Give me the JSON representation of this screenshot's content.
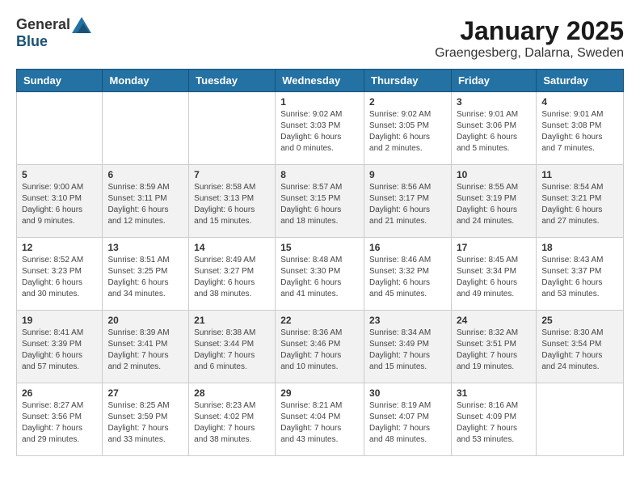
{
  "logo": {
    "general": "General",
    "blue": "Blue"
  },
  "title": "January 2025",
  "subtitle": "Graengesberg, Dalarna, Sweden",
  "days_of_week": [
    "Sunday",
    "Monday",
    "Tuesday",
    "Wednesday",
    "Thursday",
    "Friday",
    "Saturday"
  ],
  "weeks": [
    [
      {
        "day": "",
        "info": ""
      },
      {
        "day": "",
        "info": ""
      },
      {
        "day": "",
        "info": ""
      },
      {
        "day": "1",
        "info": "Sunrise: 9:02 AM\nSunset: 3:03 PM\nDaylight: 6 hours\nand 0 minutes."
      },
      {
        "day": "2",
        "info": "Sunrise: 9:02 AM\nSunset: 3:05 PM\nDaylight: 6 hours\nand 2 minutes."
      },
      {
        "day": "3",
        "info": "Sunrise: 9:01 AM\nSunset: 3:06 PM\nDaylight: 6 hours\nand 5 minutes."
      },
      {
        "day": "4",
        "info": "Sunrise: 9:01 AM\nSunset: 3:08 PM\nDaylight: 6 hours\nand 7 minutes."
      }
    ],
    [
      {
        "day": "5",
        "info": "Sunrise: 9:00 AM\nSunset: 3:10 PM\nDaylight: 6 hours\nand 9 minutes."
      },
      {
        "day": "6",
        "info": "Sunrise: 8:59 AM\nSunset: 3:11 PM\nDaylight: 6 hours\nand 12 minutes."
      },
      {
        "day": "7",
        "info": "Sunrise: 8:58 AM\nSunset: 3:13 PM\nDaylight: 6 hours\nand 15 minutes."
      },
      {
        "day": "8",
        "info": "Sunrise: 8:57 AM\nSunset: 3:15 PM\nDaylight: 6 hours\nand 18 minutes."
      },
      {
        "day": "9",
        "info": "Sunrise: 8:56 AM\nSunset: 3:17 PM\nDaylight: 6 hours\nand 21 minutes."
      },
      {
        "day": "10",
        "info": "Sunrise: 8:55 AM\nSunset: 3:19 PM\nDaylight: 6 hours\nand 24 minutes."
      },
      {
        "day": "11",
        "info": "Sunrise: 8:54 AM\nSunset: 3:21 PM\nDaylight: 6 hours\nand 27 minutes."
      }
    ],
    [
      {
        "day": "12",
        "info": "Sunrise: 8:52 AM\nSunset: 3:23 PM\nDaylight: 6 hours\nand 30 minutes."
      },
      {
        "day": "13",
        "info": "Sunrise: 8:51 AM\nSunset: 3:25 PM\nDaylight: 6 hours\nand 34 minutes."
      },
      {
        "day": "14",
        "info": "Sunrise: 8:49 AM\nSunset: 3:27 PM\nDaylight: 6 hours\nand 38 minutes."
      },
      {
        "day": "15",
        "info": "Sunrise: 8:48 AM\nSunset: 3:30 PM\nDaylight: 6 hours\nand 41 minutes."
      },
      {
        "day": "16",
        "info": "Sunrise: 8:46 AM\nSunset: 3:32 PM\nDaylight: 6 hours\nand 45 minutes."
      },
      {
        "day": "17",
        "info": "Sunrise: 8:45 AM\nSunset: 3:34 PM\nDaylight: 6 hours\nand 49 minutes."
      },
      {
        "day": "18",
        "info": "Sunrise: 8:43 AM\nSunset: 3:37 PM\nDaylight: 6 hours\nand 53 minutes."
      }
    ],
    [
      {
        "day": "19",
        "info": "Sunrise: 8:41 AM\nSunset: 3:39 PM\nDaylight: 6 hours\nand 57 minutes."
      },
      {
        "day": "20",
        "info": "Sunrise: 8:39 AM\nSunset: 3:41 PM\nDaylight: 7 hours\nand 2 minutes."
      },
      {
        "day": "21",
        "info": "Sunrise: 8:38 AM\nSunset: 3:44 PM\nDaylight: 7 hours\nand 6 minutes."
      },
      {
        "day": "22",
        "info": "Sunrise: 8:36 AM\nSunset: 3:46 PM\nDaylight: 7 hours\nand 10 minutes."
      },
      {
        "day": "23",
        "info": "Sunrise: 8:34 AM\nSunset: 3:49 PM\nDaylight: 7 hours\nand 15 minutes."
      },
      {
        "day": "24",
        "info": "Sunrise: 8:32 AM\nSunset: 3:51 PM\nDaylight: 7 hours\nand 19 minutes."
      },
      {
        "day": "25",
        "info": "Sunrise: 8:30 AM\nSunset: 3:54 PM\nDaylight: 7 hours\nand 24 minutes."
      }
    ],
    [
      {
        "day": "26",
        "info": "Sunrise: 8:27 AM\nSunset: 3:56 PM\nDaylight: 7 hours\nand 29 minutes."
      },
      {
        "day": "27",
        "info": "Sunrise: 8:25 AM\nSunset: 3:59 PM\nDaylight: 7 hours\nand 33 minutes."
      },
      {
        "day": "28",
        "info": "Sunrise: 8:23 AM\nSunset: 4:02 PM\nDaylight: 7 hours\nand 38 minutes."
      },
      {
        "day": "29",
        "info": "Sunrise: 8:21 AM\nSunset: 4:04 PM\nDaylight: 7 hours\nand 43 minutes."
      },
      {
        "day": "30",
        "info": "Sunrise: 8:19 AM\nSunset: 4:07 PM\nDaylight: 7 hours\nand 48 minutes."
      },
      {
        "day": "31",
        "info": "Sunrise: 8:16 AM\nSunset: 4:09 PM\nDaylight: 7 hours\nand 53 minutes."
      },
      {
        "day": "",
        "info": ""
      }
    ]
  ]
}
